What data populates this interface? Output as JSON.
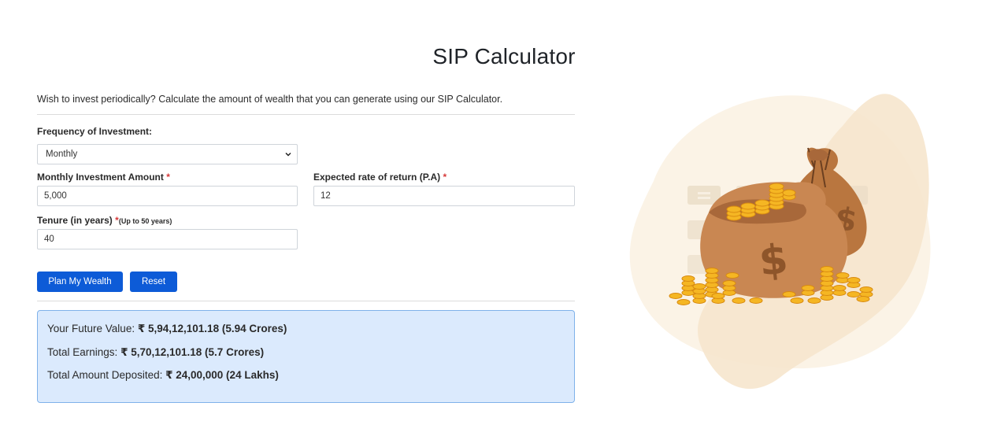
{
  "page": {
    "title": "SIP Calculator",
    "intro": "Wish to invest periodically? Calculate the amount of wealth that you can generate using our SIP Calculator."
  },
  "form": {
    "frequency_label": "Frequency of Investment:",
    "frequency_value": "Monthly",
    "amount_label": "Monthly Investment Amount",
    "amount_value": "5,000",
    "rate_label": "Expected rate of return (P.A)",
    "rate_value": "12",
    "tenure_label": "Tenure (in years)",
    "tenure_hint": "(Up to 50 years)",
    "tenure_value": "40",
    "required_mark": "*"
  },
  "buttons": {
    "plan_label": "Plan My Wealth",
    "reset_label": "Reset"
  },
  "results": {
    "future_label": "Your Future Value:",
    "future_value": "₹  5,94,12,101.18 (5.94 Crores)",
    "earnings_label": "Total Earnings:",
    "earnings_value": "₹ 5,70,12,101.18 (5.7 Crores)",
    "deposited_label": "Total Amount Deposited:",
    "deposited_value": "₹ 24,00,000 (24 Lakhs)"
  },
  "illustration": {
    "icon": "money-bags-icon",
    "colors": {
      "blob_light": "#fbf3e6",
      "blob_dark": "#f6e6cd",
      "bag": "#c98752",
      "bag_dark": "#a8683a",
      "coin": "#f5b623"
    }
  },
  "colors": {
    "accent": "#0d5bd7",
    "result_bg": "#dbeafd",
    "result_border": "#7fb2ea",
    "required": "#d63939"
  }
}
